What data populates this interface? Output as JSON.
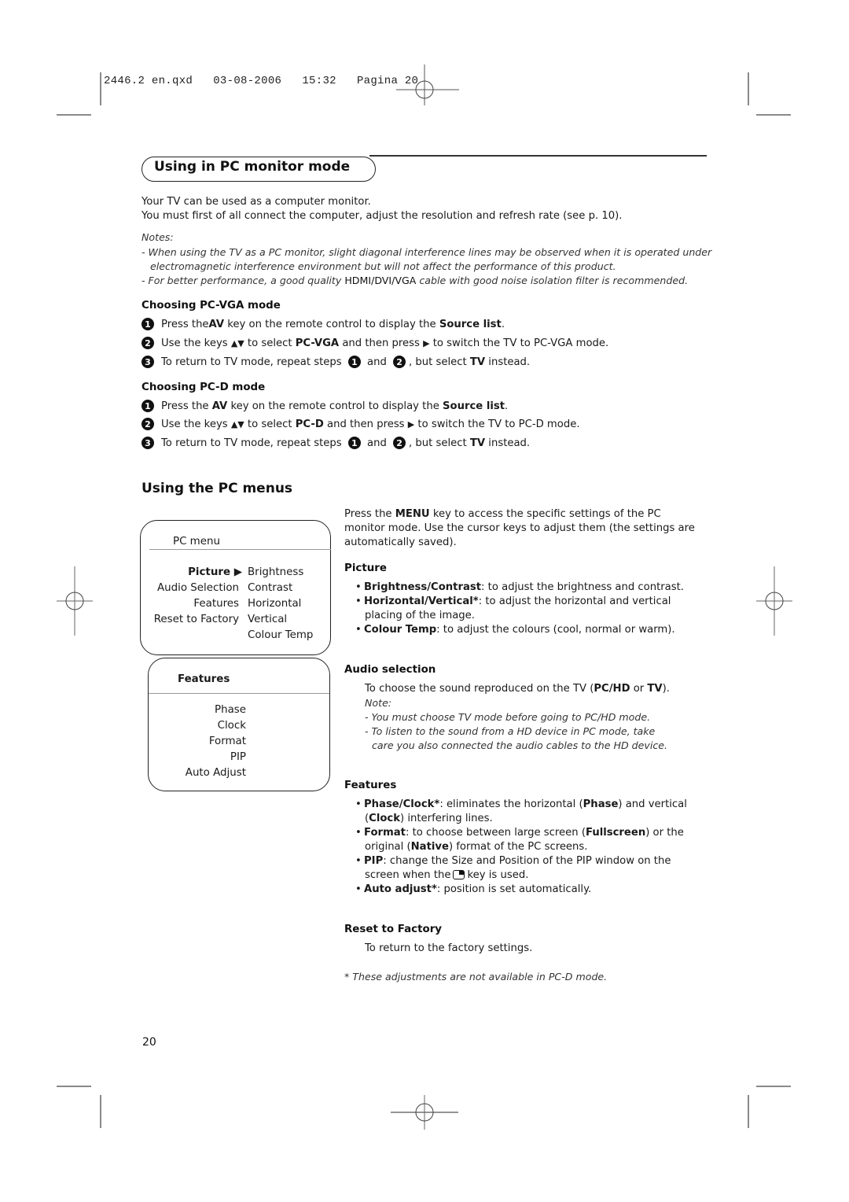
{
  "slug": "2446.2 en.qxd   03-08-2006   15:32   Pagina 20",
  "title": "Using in PC monitor mode",
  "intro": [
    "Your TV can be used as a computer monitor.",
    "You must first of all connect the computer, adjust the resolution and refresh rate (see p. 10)."
  ],
  "notes": {
    "heading": "Notes:",
    "line1": "- When using the TV as a PC monitor, slight diagonal interference lines may be observed when it is operated under",
    "line1b": "electromagnetic interference environment but will not affect the performance of this product.",
    "line2_pre": "- For better performance, a good quality ",
    "line2_bold": "HDMI/DVI/VGA",
    "line2_post": " cable with good noise isolation filter is recommended."
  },
  "vga": {
    "heading": "Choosing PC-VGA mode",
    "s1": {
      "num": "1",
      "a": "Press the ",
      "b": "AV",
      "c": " key on the remote control to display the ",
      "d": "Source list",
      "e": "."
    },
    "s2": {
      "num": "2",
      "a": "Use the keys ",
      "arrows": "▲▼",
      "b": " to select ",
      "c": "PC-VGA",
      "d": " and then press ",
      "arrow": "▶",
      "e": " to switch the TV to PC-VGA mode."
    },
    "s3": {
      "num": "3",
      "a": "To return to TV mode, repeat steps ",
      "n1": "1",
      "b": " and ",
      "n2": "2",
      "c": ", but select ",
      "d": "TV",
      "e": " instead."
    }
  },
  "pcd": {
    "heading": "Choosing PC-D mode",
    "s1": {
      "num": "1",
      "a": "Press the ",
      "b": "AV",
      "c": " key on the remote control to display the ",
      "d": "Source list",
      "e": "."
    },
    "s2": {
      "num": "2",
      "a": "Use the keys ",
      "arrows": "▲▼",
      "b": " to select ",
      "c": "PC-D",
      "d": " and then press ",
      "arrow": "▶",
      "e": " to switch the TV to PC-D mode."
    },
    "s3": {
      "num": "3",
      "a": "To return to TV mode, repeat steps ",
      "n1": "1",
      "b": " and ",
      "n2": "2",
      "c": ", but select ",
      "d": "TV",
      "e": " instead."
    }
  },
  "pc_menus_heading": "Using the PC menus",
  "pc_menu": {
    "title": "PC menu",
    "left": [
      "Picture ▶",
      "Audio Selection",
      "Features",
      "Reset to Factory"
    ],
    "right": [
      "Brightness",
      "Contrast",
      "Horizontal",
      "Vertical",
      "Colour Temp"
    ]
  },
  "features_menu": {
    "title": "Features",
    "items": [
      "Phase",
      "Clock",
      "Format",
      "PIP",
      "Auto Adjust"
    ]
  },
  "right": {
    "intro": {
      "l1a": "Press the ",
      "l1b": "MENU",
      "l1c": " key to access the specific settings of the PC",
      "l2": "monitor mode. Use the cursor keys to adjust them (the settings are",
      "l3": "automatically saved)."
    },
    "picture": {
      "heading": "Picture",
      "b1": {
        "bold": "Brightness/Contrast",
        "text": ": to adjust the brightness and contrast."
      },
      "b2": {
        "bold": "Horizontal/Vertical*",
        "text": ": to adjust the horizontal and vertical",
        "cont": "placing of the image."
      },
      "b3": {
        "bold": "Colour Temp",
        "text": ": to adjust the colours (cool, normal or warm)."
      }
    },
    "audio": {
      "heading": "Audio selection",
      "l1a": "To choose the sound reproduced on the TV (",
      "l1b": "PC/HD",
      "l1c": " or ",
      "l1d": "TV",
      "l1e": ").",
      "note": "Note:",
      "n1": "- You must choose TV mode before going to PC/HD mode.",
      "n2": "- To listen to the sound from a HD device in PC mode, take",
      "n2b": "care you also connected the audio cables to the HD device."
    },
    "features": {
      "heading": "Features",
      "b1": {
        "bold": "Phase/Clock*",
        "t1": ": eliminates the horizontal (",
        "b": "Phase",
        "t2": ") and vertical",
        "c1": "(",
        "cb": "Clock",
        "c2": ") interfering lines."
      },
      "b2": {
        "bold": "Format",
        "t1": ": to choose between large screen (",
        "b": "Fullscreen",
        "t2": ") or the",
        "c1": "original (",
        "cb": "Native",
        "c2": ") format of the PC screens."
      },
      "b3": {
        "bold": "PIP",
        "t1": ": change the Size and Position of the PIP window on the",
        "c1": "screen when the",
        "c2": "key is used."
      },
      "b4": {
        "bold": "Auto adjust*",
        "t1": ": position is set automatically."
      }
    },
    "reset": {
      "heading": "Reset to Factory",
      "text": "To return to the factory settings."
    },
    "footnote": "* These adjustments are not available in PC-D mode."
  },
  "page_number": "20"
}
